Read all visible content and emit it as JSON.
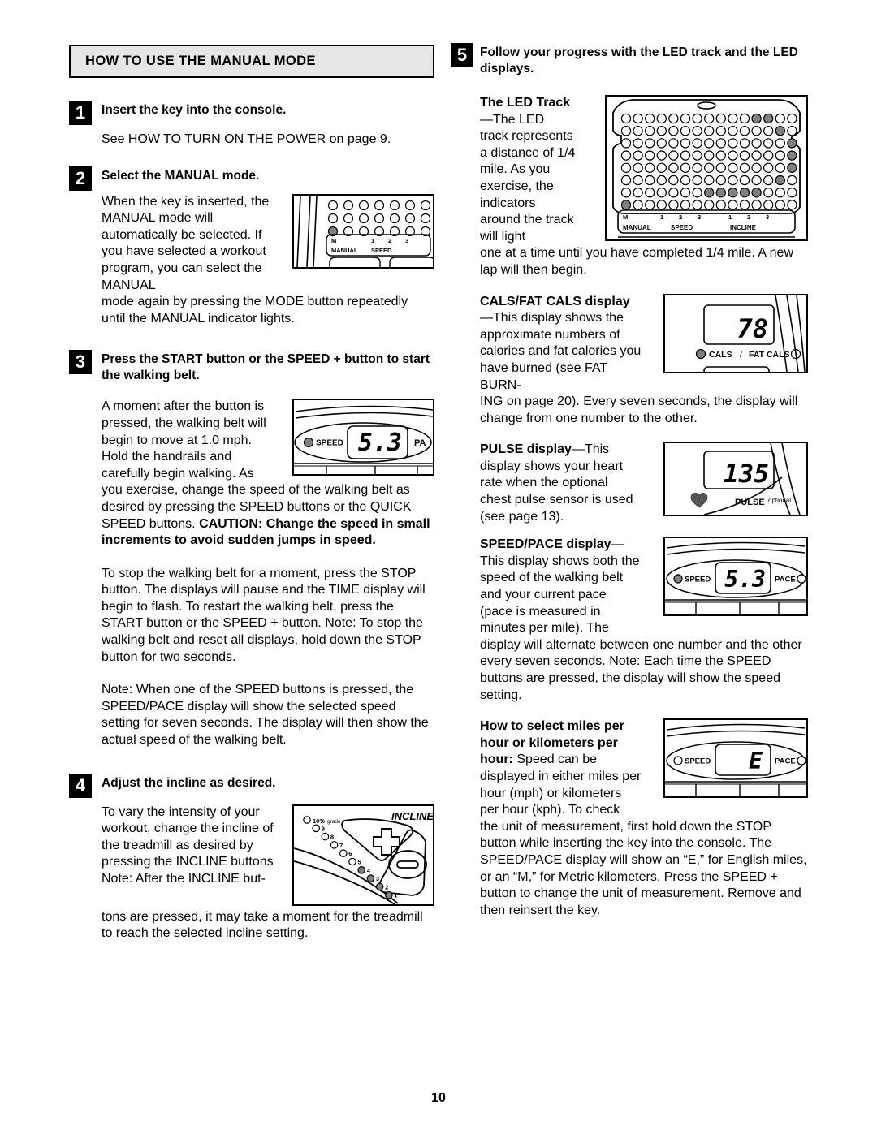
{
  "page_number": "10",
  "left_column": {
    "section_heading": "HOW TO USE THE MANUAL MODE",
    "step1": {
      "number": "1",
      "title": "Insert the key into the console.",
      "body": "See HOW TO TURN ON THE POWER on page 9."
    },
    "step2": {
      "number": "2",
      "title": "Select the MANUAL mode.",
      "body_narrow": "When the key is inserted, the MANUAL mode will automatically be selected. If you have selected a workout program, you can select the MANUAL",
      "body_full": "mode again by pressing the MODE button repeatedly until the MANUAL indicator lights."
    },
    "step3": {
      "number": "3",
      "title": "Press the START button or the SPEED + button to start the walking belt.",
      "body_narrow": "A moment after the button is pressed, the walking belt will begin to move at 1.0 mph. Hold the handrails and carefully begin walking. As",
      "body_full_1": "you exercise, change the speed of the walking belt as desired by pressing the SPEED buttons or the QUICK SPEED buttons. ",
      "body_full_1_bold": "CAUTION: Change the speed in small increments to avoid sudden jumps in speed.",
      "body_full_2": "To stop the walking belt for a moment, press the STOP button. The displays will pause and the TIME display will begin to flash. To restart the walking belt, press the START button or the SPEED + button. Note: To stop the walking belt and reset all displays, hold down the STOP button for two seconds.",
      "body_full_3": "Note: When one of the SPEED buttons is pressed, the SPEED/PACE display will show the selected speed setting for seven seconds. The display will then show the actual speed of the walking belt."
    },
    "step4": {
      "number": "4",
      "title": "Adjust the incline as desired.",
      "body_narrow": "To vary the intensity of your workout, change the incline of the treadmill as desired by pressing the INCLINE buttons Note: After the INCLINE but-",
      "body_full": "tons are pressed, it may take a moment for the treadmill to reach the selected incline setting."
    }
  },
  "right_column": {
    "step5": {
      "number": "5",
      "title": "Follow your progress with the LED track and the LED displays."
    },
    "led_track": {
      "heading": "The LED Track",
      "dash": "—",
      "body_narrow": "The LED track represents a distance of 1/4 mile. As you exercise, the indicators around the track will light",
      "body_full": "one at a time until you have completed 1/4 mile. A new lap will then begin."
    },
    "cals": {
      "heading": "CALS/FAT CALS display",
      "dash": "—",
      "body_narrow": "This display shows the approximate numbers of calories and fat calories you have burned (see FAT BURN-",
      "body_full": "ING on page 20). Every seven seconds, the display will change from one number to the other."
    },
    "pulse": {
      "heading": "PULSE display",
      "dash": "—",
      "body_narrow": "This display shows your heart rate when the optional chest pulse sensor is used (see page 13)."
    },
    "speedpace": {
      "heading": "SPEED/PACE display",
      "dash": "—",
      "body_narrow": "This display shows both the speed of the walking belt and your current pace (pace is measured in minutes per mile). The",
      "body_full": "display will alternate between one number and the other every seven seconds. Note: Each time the SPEED buttons are pressed, the display will show the speed setting."
    },
    "units": {
      "heading": "How to select miles per hour or kilometers per hour",
      "colon": ":",
      "body_narrow": " Speed can be displayed in either miles per hour (mph) or kilometers per hour (kph). To check",
      "body_full": "the unit of measurement, first hold down the STOP button while inserting the key into the console. The SPEED/PACE display will show an “E,” for English miles, or an “M,” for Metric kilometers. Press the SPEED + button to change the unit of measurement. Remove and then reinsert the key."
    }
  },
  "figures": {
    "console_manual": {
      "rows": 3,
      "cols": 7,
      "lit": [
        [
          2,
          0
        ]
      ],
      "labels": {
        "m": "M",
        "one": "1",
        "two": "2",
        "three": "3",
        "manual": "MANUAL",
        "speed": "SPEED"
      }
    },
    "speed_display_53": {
      "value": "5.3",
      "left_label": "SPEED",
      "left_lit": true,
      "right_label": "PA",
      "right_lit": false
    },
    "incline": {
      "title": "INCLINE",
      "top_label": "10%grade",
      "dot_labels": [
        "9",
        "8",
        "7",
        "6",
        "5",
        "4",
        "3",
        "2",
        "1"
      ],
      "lit_labels": [
        "4",
        "3",
        "2",
        "1"
      ],
      "plus_label": "+",
      "minus_label": "-"
    },
    "led_track_figure": {
      "rows": 8,
      "cols": 15,
      "lit": [
        [
          0,
          11
        ],
        [
          0,
          12
        ],
        [
          1,
          13
        ],
        [
          2,
          14
        ],
        [
          3,
          14
        ],
        [
          4,
          14
        ],
        [
          5,
          13
        ],
        [
          6,
          7
        ],
        [
          6,
          8
        ],
        [
          6,
          9
        ],
        [
          6,
          10
        ],
        [
          6,
          11
        ],
        [
          7,
          0
        ]
      ],
      "labels": {
        "m": "M",
        "speed_ticks": [
          "1",
          "2",
          "3"
        ],
        "incline_ticks": [
          "1",
          "2",
          "3"
        ],
        "manual": "MANUAL",
        "speed": "SPEED",
        "incline": "INCLINE"
      }
    },
    "cals_display": {
      "value": "78",
      "left_label": "CALS",
      "separator": "/",
      "right_label": "FAT CALS",
      "left_lit": true,
      "right_lit": false
    },
    "pulse_display": {
      "value": "135",
      "label": "PULSE",
      "sub_label": "optional",
      "heart_icon": "heart-icon"
    },
    "speedpace_display": {
      "value": "5.3",
      "left_label": "SPEED",
      "right_label": "PACE",
      "left_lit": true,
      "right_lit": false
    },
    "units_display": {
      "value": "E",
      "left_label": "SPEED",
      "right_label": "PACE",
      "left_lit": false,
      "right_lit": false
    }
  },
  "colors": {
    "lit_dot": "#808080",
    "unlit_dot": "#ffffff",
    "heading_bg": "#e6e6e6",
    "ink": "#000000"
  }
}
